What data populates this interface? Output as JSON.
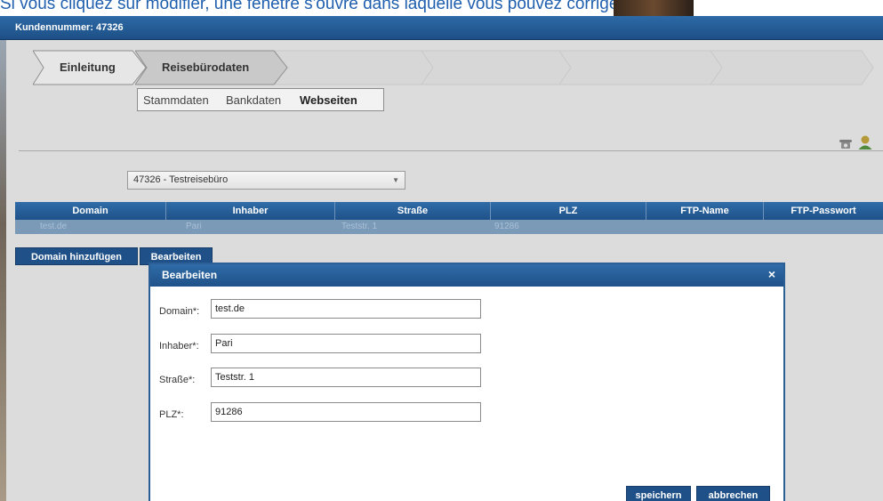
{
  "caption": "Si vous cliquez sur modifier, une fenêtre s'ouvre dans laquelle vous pouvez corriger",
  "header": {
    "customer_number": "Kundennummer: 47326"
  },
  "steps": [
    {
      "label": "Einleitung",
      "state": "done"
    },
    {
      "label": "Reisebürodaten",
      "state": "active"
    }
  ],
  "subtabs": {
    "tab1": "Stammdaten",
    "tab2": "Bankdaten",
    "tab3": "Webseiten",
    "active": "Webseiten"
  },
  "agency_select": {
    "value": "47326 - Testreisebüro"
  },
  "grid": {
    "columns": [
      "Domain",
      "Inhaber",
      "Straße",
      "PLZ",
      "FTP-Name",
      "FTP-Passwort"
    ],
    "rows": [
      {
        "domain": "test.de",
        "owner": "Pari",
        "street": "Teststr. 1",
        "zip": "91286",
        "ftp_name": "",
        "ftp_password": ""
      }
    ]
  },
  "actions": {
    "add_domain": "Domain hinzufügen",
    "edit": "Bearbeiten"
  },
  "modal": {
    "title": "Bearbeiten",
    "close_symbol": "×",
    "fields": {
      "domain": {
        "label": "Domain*:",
        "value": "test.de"
      },
      "owner": {
        "label": "Inhaber*:",
        "value": "Pari"
      },
      "street": {
        "label": "Straße*:",
        "value": "Teststr. 1"
      },
      "zip": {
        "label": "PLZ*:",
        "value": "91286"
      }
    },
    "save_label": "speichern",
    "cancel_label": "abbrechen"
  },
  "colors": {
    "accent": "#1f5088",
    "header": "#2d6aa6",
    "panel": "#dcdcdc"
  },
  "icons": [
    "phone-icon",
    "user-icon",
    "dropdown-arrow-icon",
    "close-icon"
  ]
}
